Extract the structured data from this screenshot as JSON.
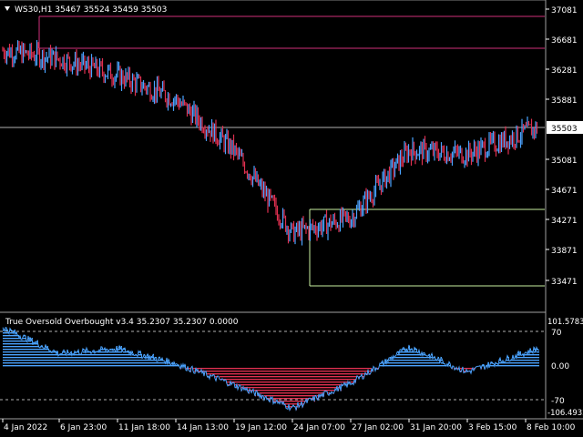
{
  "chart_header": {
    "title": "WS30,H1  35467 35524 35459 35503",
    "menu_icon": "triangle-down-icon"
  },
  "price_axis": {
    "labels": [
      "37081",
      "36681",
      "36281",
      "35881",
      "35481",
      "35081",
      "34671",
      "34271",
      "33871",
      "33471"
    ],
    "current_price": "35503"
  },
  "indicator": {
    "title": "True Oversold Overbought v3.4 35.2307 35.2307 0.0000",
    "axis_labels": [
      "101.5783",
      "70",
      "0.00",
      "-70",
      "-106.4932"
    ]
  },
  "time_axis": {
    "labels": [
      "4 Jan 2022",
      "6 Jan 23:00",
      "11 Jan 18:00",
      "14 Jan 13:00",
      "19 Jan 12:00",
      "24 Jan 07:00",
      "27 Jan 02:00",
      "31 Jan 20:00",
      "3 Feb 15:00",
      "8 Feb 10:00"
    ]
  },
  "colors": {
    "background": "#000000",
    "bull": "#4aa3ff",
    "bear": "#e03050",
    "hline_red": "#d0307a",
    "hline_green": "#c8f0a0",
    "current_line": "#b0b0b0"
  },
  "chart_data": [
    {
      "type": "line",
      "title": "WS30,H1  35467 35524 35459 35503",
      "x": [
        "4 Jan 2022",
        "6 Jan 23:00",
        "11 Jan 18:00",
        "14 Jan 13:00",
        "19 Jan 12:00",
        "24 Jan 07:00",
        "27 Jan 02:00",
        "31 Jan 20:00",
        "3 Feb 15:00",
        "8 Feb 10:00"
      ],
      "series": [
        {
          "values": [
            36530,
            36420,
            36200,
            35880,
            35200,
            34100,
            34300,
            35200,
            35150,
            35503
          ]
        }
      ],
      "ylim": [
        33300,
        37200
      ]
    },
    {
      "type": "area",
      "title": "True Oversold Overbought v3.4 35.2307 35.2307 0.0000",
      "x": [
        "4 Jan 2022",
        "6 Jan 23:00",
        "11 Jan 18:00",
        "14 Jan 13:00",
        "19 Jan 12:00",
        "24 Jan 07:00",
        "27 Jan 02:00",
        "31 Jan 20:00",
        "3 Feb 15:00",
        "8 Feb 10:00"
      ],
      "series": [
        {
          "values": [
            78,
            25,
            35,
            5,
            -38,
            -85,
            -35,
            38,
            -12,
            35.2307
          ]
        }
      ],
      "ylim": [
        -106.4932,
        101.5783
      ]
    }
  ]
}
